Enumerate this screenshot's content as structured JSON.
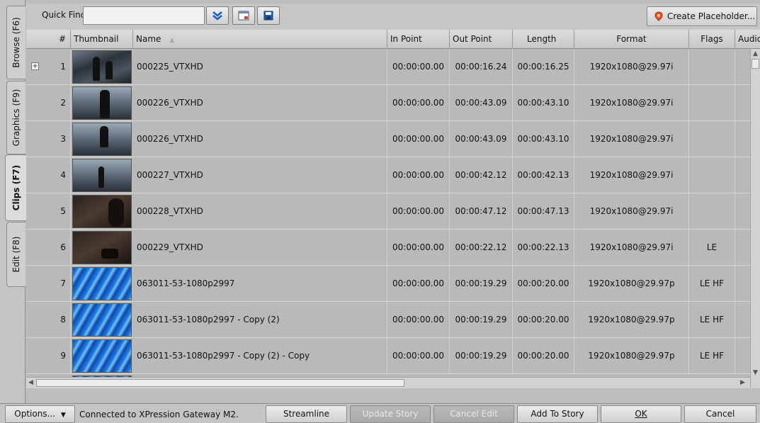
{
  "tabs": [
    {
      "label": "Browse (F6)",
      "active": false
    },
    {
      "label": "Graphics (F9)",
      "active": false
    },
    {
      "label": "Clips (F7)",
      "active": true
    },
    {
      "label": "Edit (F8)",
      "active": false
    }
  ],
  "toolbar": {
    "quick_find_label": "Quick Find:",
    "quick_find_value": "",
    "create_placeholder_label": "Create Placeholder..."
  },
  "columns": [
    "#",
    "Thumbnail",
    "Name",
    "In Point",
    "Out Point",
    "Length",
    "Format",
    "Flags",
    "Audio"
  ],
  "rows": [
    {
      "num": "1",
      "name": "000225_VTXHD",
      "in": "00:00:00.00",
      "out": "00:00:16.24",
      "length": "00:00:16.25",
      "format": "1920x1080@29.97i",
      "flags": "",
      "thumb": "dark"
    },
    {
      "num": "2",
      "name": "000226_VTXHD",
      "in": "00:00:00.00",
      "out": "00:00:43.09",
      "length": "00:00:43.10",
      "format": "1920x1080@29.97i",
      "flags": "",
      "thumb": "dark2"
    },
    {
      "num": "3",
      "name": "000226_VTXHD",
      "in": "00:00:00.00",
      "out": "00:00:43.09",
      "length": "00:00:43.10",
      "format": "1920x1080@29.97i",
      "flags": "",
      "thumb": "dark2"
    },
    {
      "num": "4",
      "name": "000227_VTXHD",
      "in": "00:00:00.00",
      "out": "00:00:42.12",
      "length": "00:00:42.13",
      "format": "1920x1080@29.97i",
      "flags": "",
      "thumb": "dark2"
    },
    {
      "num": "5",
      "name": "000228_VTXHD",
      "in": "00:00:00.00",
      "out": "00:00:47.12",
      "length": "00:00:47.13",
      "format": "1920x1080@29.97i",
      "flags": "",
      "thumb": "brown"
    },
    {
      "num": "6",
      "name": "000229_VTXHD",
      "in": "00:00:00.00",
      "out": "00:00:22.12",
      "length": "00:00:22.13",
      "format": "1920x1080@29.97i",
      "flags": "LE",
      "thumb": "brown"
    },
    {
      "num": "7",
      "name": "063011-53-1080p2997",
      "in": "00:00:00.00",
      "out": "00:00:19.29",
      "length": "00:00:20.00",
      "format": "1920x1080@29.97p",
      "flags": "LE HF",
      "thumb": "blue"
    },
    {
      "num": "8",
      "name": "063011-53-1080p2997 - Copy (2)",
      "in": "00:00:00.00",
      "out": "00:00:19.29",
      "length": "00:00:20.00",
      "format": "1920x1080@29.97p",
      "flags": "LE HF",
      "thumb": "blue"
    },
    {
      "num": "9",
      "name": "063011-53-1080p2997 - Copy (2) - Copy",
      "in": "00:00:00.00",
      "out": "00:00:19.29",
      "length": "00:00:20.00",
      "format": "1920x1080@29.97p",
      "flags": "LE HF",
      "thumb": "blue"
    }
  ],
  "bottom": {
    "options_label": "Options...",
    "status_text": "Connected to XPression Gateway M2.",
    "streamline_label": "Streamline",
    "update_story_label": "Update Story",
    "cancel_edit_label": "Cancel Edit",
    "add_to_story_label": "Add To Story",
    "ok_label": "OK",
    "cancel_label": "Cancel"
  }
}
